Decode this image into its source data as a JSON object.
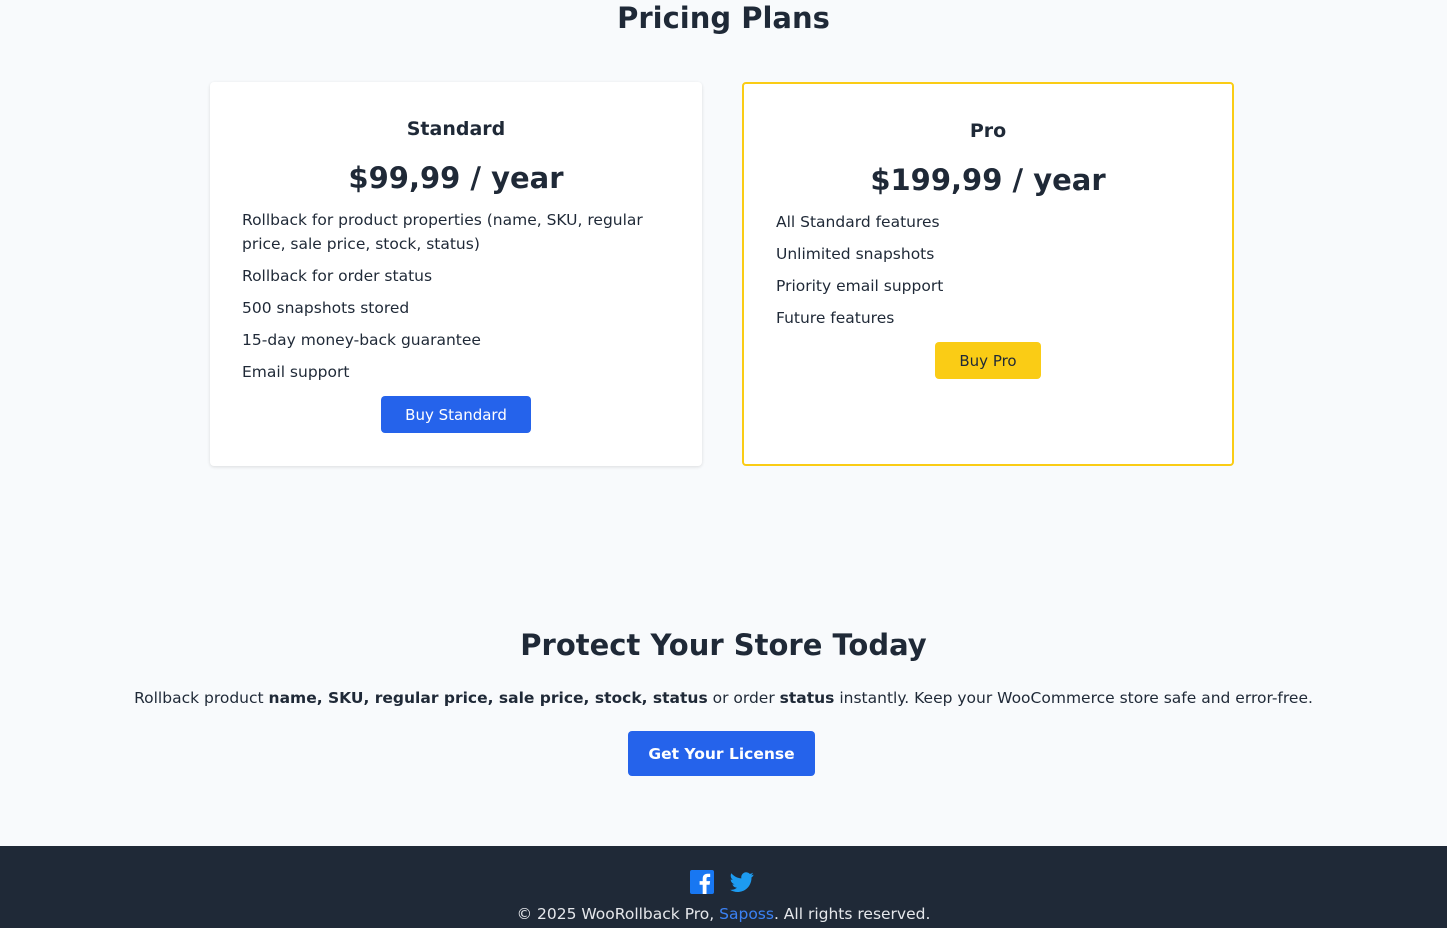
{
  "pricing": {
    "title": "Pricing Plans",
    "plans": [
      {
        "name": "Standard",
        "price": "$99,99 / year",
        "features": [
          "Rollback for product properties (name, SKU, regular price, sale price, stock, status)",
          "Rollback for order status",
          "500 snapshots stored",
          "15-day money-back guarantee",
          "Email support"
        ],
        "button": "Buy Standard",
        "button_color": "#2563eb"
      },
      {
        "name": "Pro",
        "price": "$199,99 / year",
        "features": [
          "All Standard features",
          "Unlimited snapshots",
          "Priority email support",
          "Future features"
        ],
        "button": "Buy Pro",
        "button_color": "#facc15",
        "highlight_color": "#facc15"
      }
    ]
  },
  "cta": {
    "title": "Protect Your Store Today",
    "text_parts": [
      "Rollback product ",
      "name, SKU, regular price, sale price, stock, status",
      " or order ",
      "status",
      " instantly. Keep your WooCommerce store safe and error-free."
    ],
    "button": "Get Your License"
  },
  "footer": {
    "social_icons": [
      "facebook-icon",
      "twitter-icon"
    ],
    "copyright_prefix": "© 2025 WooRollback Pro, ",
    "link_text": "Saposs",
    "copyright_suffix": ". All rights reserved.",
    "background": "#1f2937",
    "link_color": "#3b82f6"
  }
}
